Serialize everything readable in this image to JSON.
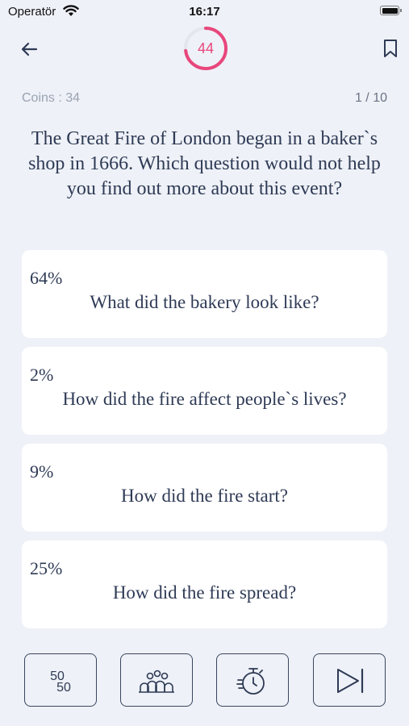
{
  "status": {
    "carrier": "Operatör",
    "time": "16:17"
  },
  "header": {
    "timer_value": "44",
    "timer_fraction": 0.73,
    "accent_color": "#e8467c"
  },
  "stats": {
    "coins_label": "Coins : 34",
    "current_question": "1",
    "separator": "/",
    "total_questions": "10"
  },
  "question": {
    "text": "The Great Fire of London began in a baker`s shop in 1666. Which question would not help you find out more about this event?"
  },
  "answers": [
    {
      "percent": "64%",
      "text": "What did the bakery look like?"
    },
    {
      "percent": "2%",
      "text": "How did the fire affect people`s lives?"
    },
    {
      "percent": "9%",
      "text": "How did the fire start?"
    },
    {
      "percent": "25%",
      "text": "How did the fire spread?"
    }
  ],
  "toolbar": {
    "fifty_top": "50",
    "fifty_bottom": "50",
    "icons": [
      "fifty-fifty-icon",
      "audience-icon",
      "stopwatch-icon",
      "skip-icon"
    ]
  }
}
